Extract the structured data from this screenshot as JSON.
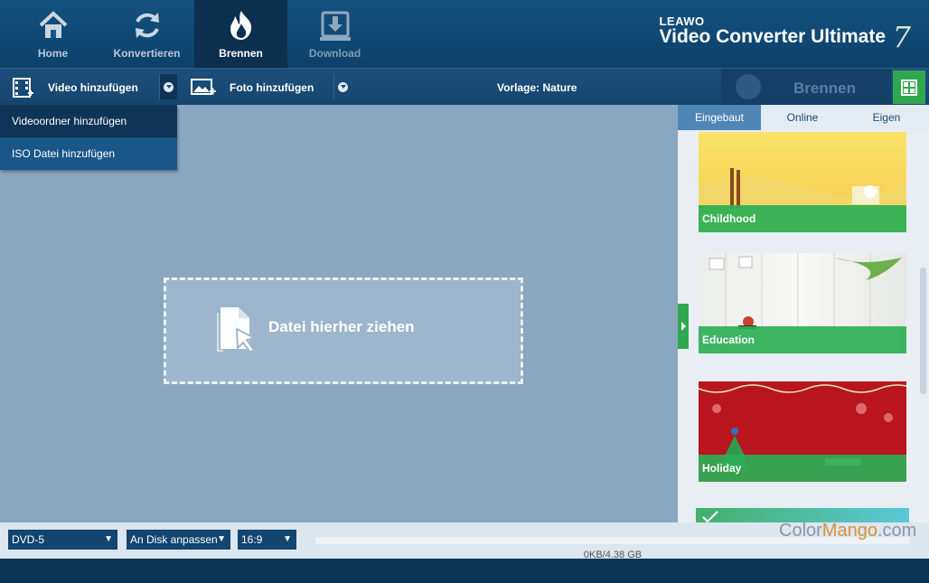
{
  "nav": {
    "items": [
      {
        "label": "Home",
        "icon": "home-icon"
      },
      {
        "label": "Konvertieren",
        "icon": "refresh-icon"
      },
      {
        "label": "Brennen",
        "icon": "flame-icon"
      },
      {
        "label": "Download",
        "icon": "download-icon"
      }
    ],
    "active": "Brennen"
  },
  "brand": {
    "leaw": "LEAWO",
    "title": "Video Converter Ultimate",
    "version": "7"
  },
  "toolbar": {
    "add_video": "Video hinzufügen",
    "add_photo": "Foto hinzufügen",
    "template": "Vorlage: Nature",
    "burn": "Brennen"
  },
  "dropdown": {
    "items": [
      "Videoordner hinzufügen",
      "ISO Datei hinzufügen"
    ]
  },
  "dropzone": {
    "label": "Datei hierher ziehen"
  },
  "right_panel": {
    "tabs": [
      "Eingebaut",
      "Online",
      "Eigen"
    ],
    "templates": [
      "Childhood",
      "Education",
      "Holiday"
    ]
  },
  "bottom": {
    "disc_type": "DVD-5",
    "fit_mode": "An Disk anpassen",
    "aspect": "16:9",
    "capacity": "0KB/4.38 GB",
    "watermark_a": "Color",
    "watermark_b": "Mango",
    "watermark_c": ".com"
  },
  "colors": {
    "accent_green": "#2fa84f",
    "nav_bg": "#14517f",
    "main_bg": "#8aa7c0"
  }
}
